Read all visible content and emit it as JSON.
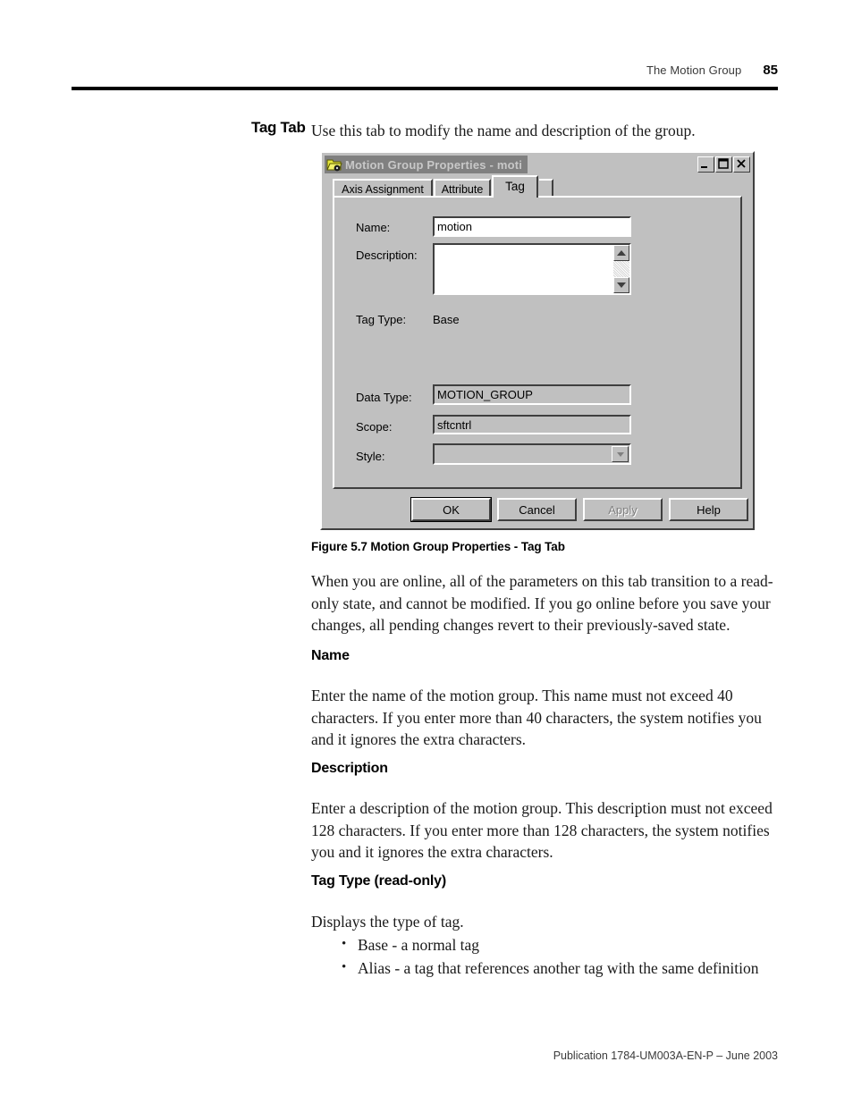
{
  "page": {
    "header_title": "The Motion Group",
    "page_number": "85",
    "footer": "Publication 1784-UM003A-EN-P – June 2003"
  },
  "section": {
    "margin_heading": "Tag Tab",
    "intro": "Use this tab to modify the name and description of the group."
  },
  "dialog": {
    "title": "Motion Group Properties - moti",
    "icon": "motion-group-folder-icon",
    "window_buttons": {
      "minimize": "minimize-icon",
      "maximize": "maximize-icon",
      "close": "close-icon"
    },
    "tabs": [
      {
        "label": "Axis Assignment",
        "active": false
      },
      {
        "label": "Attribute",
        "active": false
      },
      {
        "label": "Tag",
        "active": true
      }
    ],
    "fields": {
      "name_label": "Name:",
      "name_value": "motion",
      "description_label": "Description:",
      "description_value": "",
      "tag_type_label": "Tag Type:",
      "tag_type_value": "Base",
      "data_type_label": "Data Type:",
      "data_type_value": "MOTION_GROUP",
      "scope_label": "Scope:",
      "scope_value": "sftcntrl",
      "style_label": "Style:",
      "style_value": ""
    },
    "buttons": {
      "ok": "OK",
      "cancel": "Cancel",
      "apply": "Apply",
      "help": "Help"
    }
  },
  "figure": {
    "caption": "Figure 5.7 Motion Group Properties - Tag Tab"
  },
  "body": {
    "online_note": "When you are online, all of the parameters on this tab transition to a read-only state, and cannot be modified. If you go online before you save your changes, all pending changes revert to their previously-saved state.",
    "name_heading": "Name",
    "name_text": "Enter the name of the motion group. This name must not exceed 40 characters. If you enter more than 40 characters, the system notifies you and it ignores the extra characters.",
    "description_heading": "Description",
    "description_text": "Enter a description of the motion group. This description must not exceed 128 characters. If you enter more than 128 characters, the system notifies you and it ignores the extra characters.",
    "tag_type_heading": "Tag Type (read-only)",
    "tag_type_text": "Displays the type of tag.",
    "tag_type_bullets": [
      "Base - a normal tag",
      "Alias - a tag that references another tag with the same definition"
    ]
  }
}
